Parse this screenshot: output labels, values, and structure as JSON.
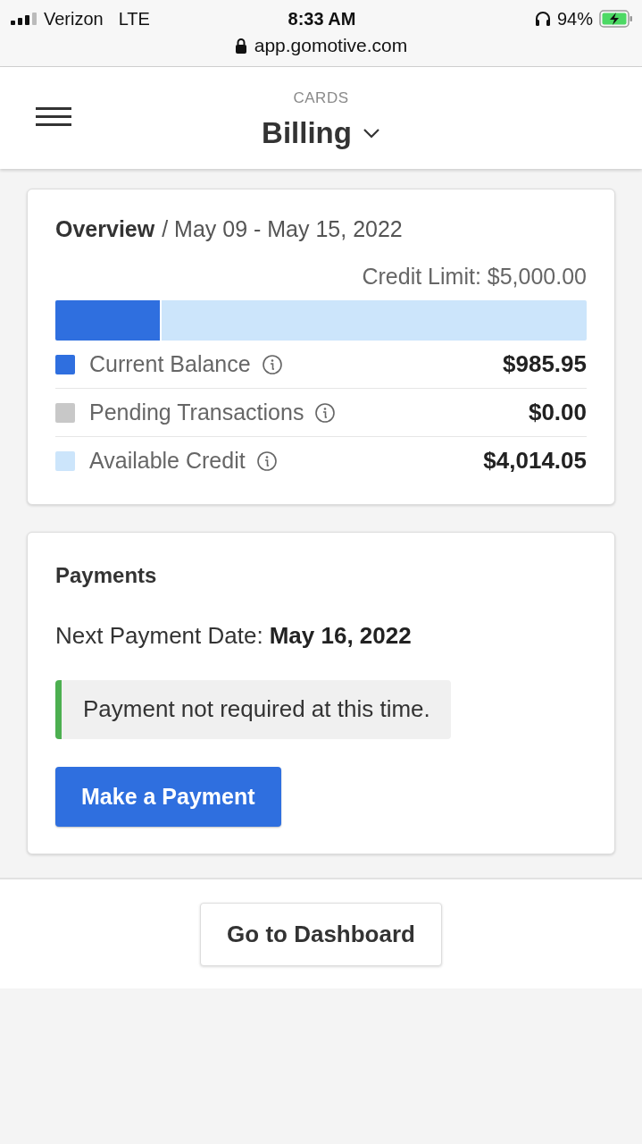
{
  "status_bar": {
    "carrier": "Verizon",
    "network": "LTE",
    "time": "8:33 AM",
    "battery": "94%",
    "url": "app.gomotive.com"
  },
  "header": {
    "section": "CARDS",
    "title": "Billing"
  },
  "overview": {
    "title": "Overview",
    "period": "/ May 09 - May 15, 2022",
    "credit_limit": "Credit Limit: $5,000.00",
    "bar": {
      "level": 0.197
    },
    "items": [
      {
        "label": "Current Balance",
        "amount": "$985.95",
        "color": "#2f6fdf"
      },
      {
        "label": "Pending Transactions",
        "amount": "$0.00",
        "color": "#c8c8c8"
      },
      {
        "label": "Available Credit",
        "amount": "$4,014.05",
        "color": "#cce5fb"
      }
    ]
  },
  "payments": {
    "title": "Payments",
    "next_label": "Next Payment Date:",
    "next_date": "May 16, 2022",
    "notice": "Payment not required at this time.",
    "button": "Make a Payment"
  },
  "footer": {
    "button": "Go to Dashboard"
  }
}
